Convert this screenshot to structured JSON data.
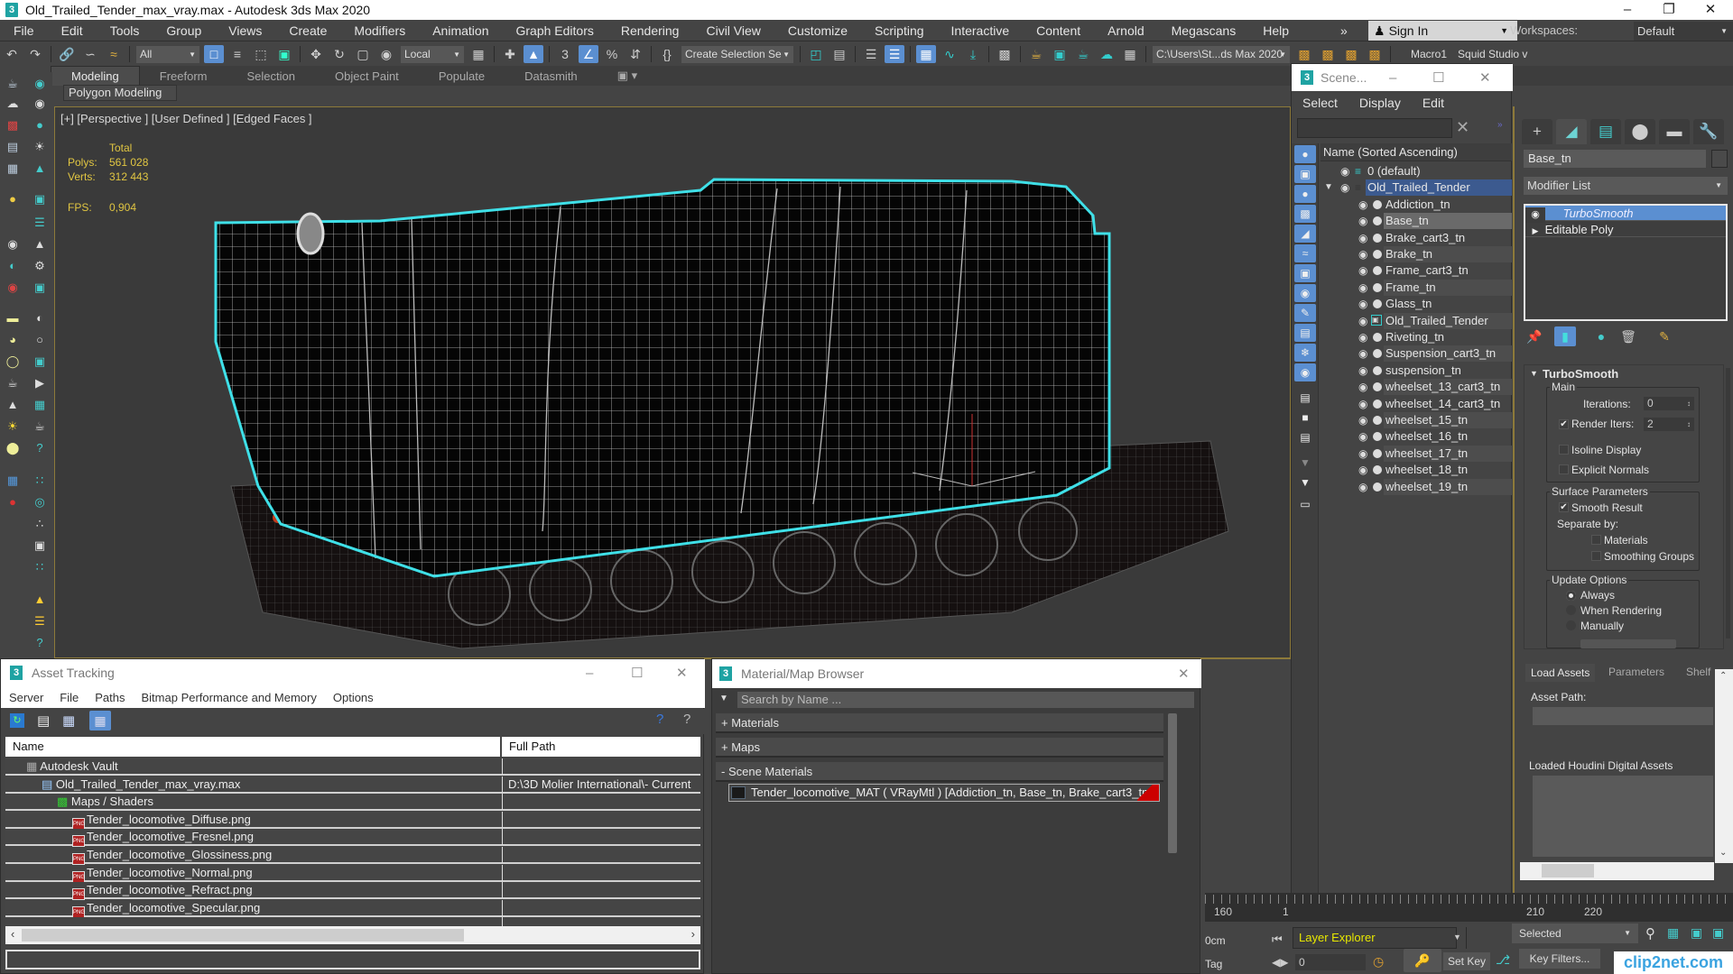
{
  "window": {
    "title": "Old_Trailed_Tender_max_vray.max - Autodesk 3ds Max 2020",
    "controls": [
      "minimize",
      "restore",
      "close"
    ]
  },
  "menubar": {
    "items": [
      "File",
      "Edit",
      "Tools",
      "Group",
      "Views",
      "Create",
      "Modifiers",
      "Animation",
      "Graph Editors",
      "Rendering",
      "Civil View",
      "Customize",
      "Scripting",
      "Interactive",
      "Content",
      "Arnold",
      "Megascans",
      "Help"
    ],
    "overflow": "»",
    "signin": "Sign In",
    "workspaces_label": "Workspaces:",
    "workspace_value": "Default"
  },
  "toolbar": {
    "selection_filter": "All",
    "coordinate_system": "Local",
    "named_selection": "Create Selection Se",
    "project_path": "C:\\Users\\St...ds Max 2020",
    "macro1": "Macro1",
    "macro2": "Squid Studio v"
  },
  "ribbon": {
    "tabs": [
      "Modeling",
      "Freeform",
      "Selection",
      "Object Paint",
      "Populate",
      "Datasmith"
    ],
    "active_tab": "Modeling",
    "panel": "Polygon Modeling"
  },
  "viewport": {
    "label": "[+] [Perspective ] [User Defined ] [Edged Faces ]",
    "stats": {
      "header": "Total",
      "polys_label": "Polys:",
      "polys": "561 028",
      "verts_label": "Verts:",
      "verts": "312 443",
      "fps_label": "FPS:",
      "fps": "0,904"
    },
    "accent_selection": "#3fe0e8",
    "border_color": "#8d7a3a"
  },
  "scene_explorer": {
    "title": "Scene...",
    "menu": [
      "Select",
      "Display",
      "Edit"
    ],
    "column_header": "Name (Sorted Ascending)",
    "rows": [
      {
        "name": "0 (default)",
        "level": 0,
        "type": "layer"
      },
      {
        "name": "Old_Trailed_Tender",
        "level": 0,
        "type": "layer",
        "selected": true,
        "expanded": true
      },
      {
        "name": "Addiction_tn",
        "level": 1,
        "type": "object"
      },
      {
        "name": "Base_tn",
        "level": 1,
        "type": "object",
        "highlighted": true
      },
      {
        "name": "Brake_cart3_tn",
        "level": 1,
        "type": "object"
      },
      {
        "name": "Brake_tn",
        "level": 1,
        "type": "object"
      },
      {
        "name": "Frame_cart3_tn",
        "level": 1,
        "type": "object"
      },
      {
        "name": "Frame_tn",
        "level": 1,
        "type": "object"
      },
      {
        "name": "Glass_tn",
        "level": 1,
        "type": "object"
      },
      {
        "name": "Old_Trailed_Tender",
        "level": 1,
        "type": "group"
      },
      {
        "name": "Riveting_tn",
        "level": 1,
        "type": "object"
      },
      {
        "name": "Suspension_cart3_tn",
        "level": 1,
        "type": "object"
      },
      {
        "name": "suspension_tn",
        "level": 1,
        "type": "object"
      },
      {
        "name": "wheelset_13_cart3_tn",
        "level": 1,
        "type": "object"
      },
      {
        "name": "wheelset_14_cart3_tn",
        "level": 1,
        "type": "object"
      },
      {
        "name": "wheelset_15_tn",
        "level": 1,
        "type": "object"
      },
      {
        "name": "wheelset_16_tn",
        "level": 1,
        "type": "object"
      },
      {
        "name": "wheelset_17_tn",
        "level": 1,
        "type": "object"
      },
      {
        "name": "wheelset_18_tn",
        "level": 1,
        "type": "object"
      },
      {
        "name": "wheelset_19_tn",
        "level": 1,
        "type": "object"
      }
    ],
    "footer_dropdown": "Layer Explorer"
  },
  "command_panel": {
    "object_name": "Base_tn",
    "modifier_list": "Modifier List",
    "stack": [
      {
        "name": "TurboSmooth",
        "selected": true
      },
      {
        "name": "Editable Poly",
        "selected": false
      }
    ],
    "rollout": {
      "title": "TurboSmooth",
      "main_label": "Main",
      "iterations_label": "Iterations:",
      "iterations": "0",
      "render_iters_label": "Render Iters:",
      "render_iters": "2",
      "render_iters_checked": true,
      "isoline_label": "Isoline Display",
      "isoline_checked": false,
      "explicit_normals_label": "Explicit Normals",
      "explicit_normals_checked": false,
      "surface_label": "Surface Parameters",
      "smooth_result_label": "Smooth Result",
      "smooth_result_checked": true,
      "separate_by_label": "Separate by:",
      "materials_label": "Materials",
      "materials_checked": false,
      "smoothing_groups_label": "Smoothing Groups",
      "smoothing_groups_checked": false,
      "update_label": "Update Options",
      "update_options": [
        "Always",
        "When Rendering",
        "Manually"
      ],
      "update_selected": "Always"
    }
  },
  "houdini": {
    "tabs": [
      "Load Assets",
      "Parameters",
      "Shelf"
    ],
    "active_tab": "Load Assets",
    "asset_path_label": "Asset Path:",
    "loaded_label": "Loaded Houdini Digital Assets"
  },
  "asset_tracking": {
    "title": "Asset Tracking",
    "menu": [
      "Server",
      "File",
      "Paths",
      "Bitmap Performance and Memory",
      "Options"
    ],
    "columns": [
      "Name",
      "Full Path"
    ],
    "rows": [
      {
        "name": "Autodesk Vault",
        "path": "",
        "indent": 1,
        "icon": "vault"
      },
      {
        "name": "Old_Trailed_Tender_max_vray.max",
        "path": "D:\\3D Molier International\\- Current",
        "indent": 2,
        "icon": "max"
      },
      {
        "name": "Maps / Shaders",
        "path": "",
        "indent": 3,
        "icon": "maps"
      },
      {
        "name": "Tender_locomotive_Diffuse.png",
        "path": "",
        "indent": 4,
        "icon": "png"
      },
      {
        "name": "Tender_locomotive_Fresnel.png",
        "path": "",
        "indent": 4,
        "icon": "png"
      },
      {
        "name": "Tender_locomotive_Glossiness.png",
        "path": "",
        "indent": 4,
        "icon": "png"
      },
      {
        "name": "Tender_locomotive_Normal.png",
        "path": "",
        "indent": 4,
        "icon": "png"
      },
      {
        "name": "Tender_locomotive_Refract.png",
        "path": "",
        "indent": 4,
        "icon": "png"
      },
      {
        "name": "Tender_locomotive_Specular.png",
        "path": "",
        "indent": 4,
        "icon": "png"
      }
    ]
  },
  "material_browser": {
    "title": "Material/Map Browser",
    "search_placeholder": "Search by Name ...",
    "categories": [
      "+ Materials",
      "+ Maps",
      "- Scene Materials"
    ],
    "scene_material": "Tender_locomotive_MAT ( VRayMtl ) [Addiction_tn, Base_tn, Brake_cart3_tn, Br..."
  },
  "timeline": {
    "ticks": [
      "160",
      "1",
      "210",
      "220"
    ],
    "coord_readout": "0cm",
    "tag_label": "Tag",
    "frame_value": "0",
    "selected_dropdown": "Selected",
    "set_key": "Set Key",
    "key_filters": "Key Filters..."
  },
  "watermark": "clip2net.com"
}
